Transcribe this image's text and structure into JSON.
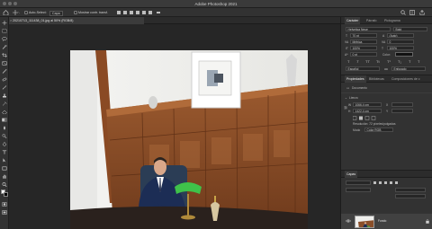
{
  "window": {
    "title": "Adobe Photoshop 2021"
  },
  "options_bar": {
    "auto_select_label": "Auto-Select:",
    "auto_select_value": "Capa",
    "transform_label": "Mostrar contr. transf."
  },
  "document": {
    "tab_title": "20210713_111438_01.jpg al 50% (RGB/8)"
  },
  "character_panel": {
    "tabs": [
      "Carácter",
      "Párrafo",
      "Pictograma"
    ],
    "font_family": "Helvetica Neue",
    "font_style": "Bold",
    "font_size": "70 pt",
    "leading": "(Auto)",
    "kerning": "Métrica",
    "tracking": "0",
    "vertical_scale": "100%",
    "horizontal_scale": "100%",
    "baseline_shift": "0 pt",
    "color_label": "Color:",
    "language": "Español",
    "antialias": "Enfocado"
  },
  "properties_panel": {
    "tabs": [
      "Propiedades",
      "Bibliotecas",
      "Composiciones de c"
    ],
    "section_document": "Documento",
    "section_canvas": "Lienzo",
    "width": "1066,4 cm",
    "height": "1422,4 cm",
    "x_label": "X",
    "y_label": "Y",
    "resolution": "Resolución: 72 píxeles/pulgadas",
    "mode_label": "Modo",
    "mode_value": "Color RGB"
  },
  "layers_panel": {
    "title": "Capas",
    "layer_name": "Fondo"
  },
  "colors": {
    "chrome": "#323232",
    "canvas_bg": "#262626",
    "wall": "#eeeeec",
    "wood": "#8a4f2a",
    "suit": "#1c2d55",
    "lamp": "#3fc24a"
  }
}
